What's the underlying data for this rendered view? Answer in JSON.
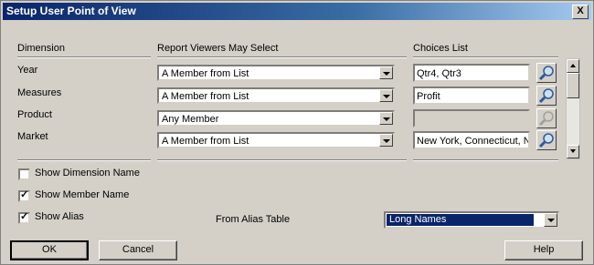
{
  "window": {
    "title": "Setup User Point of View",
    "close_glyph": "X"
  },
  "headers": {
    "dimension": "Dimension",
    "selection": "Report Viewers May Select",
    "choices": "Choices List"
  },
  "rows": [
    {
      "dimension": "Year",
      "selection": "A Member from List",
      "choices": "Qtr4, Qtr3",
      "picker_enabled": true
    },
    {
      "dimension": "Measures",
      "selection": "A Member from List",
      "choices": "Profit",
      "picker_enabled": true
    },
    {
      "dimension": "Product",
      "selection": "Any Member",
      "choices": "",
      "picker_enabled": false
    },
    {
      "dimension": "Market",
      "selection": "A Member from List",
      "choices": "New York, Connecticut, N",
      "picker_enabled": true
    }
  ],
  "options": {
    "show_dimension_name": {
      "label": "Show Dimension Name",
      "checked": false
    },
    "show_member_name": {
      "label": "Show Member Name",
      "checked": true
    },
    "show_alias": {
      "label": "Show Alias",
      "checked": true
    }
  },
  "alias": {
    "label": "From Alias Table",
    "value": "Long Names"
  },
  "buttons": {
    "ok": "OK",
    "cancel": "Cancel",
    "help": "Help"
  },
  "colors": {
    "title_bar": "#0a246a",
    "face": "#d4d0c8",
    "selection": "#0a246a"
  }
}
